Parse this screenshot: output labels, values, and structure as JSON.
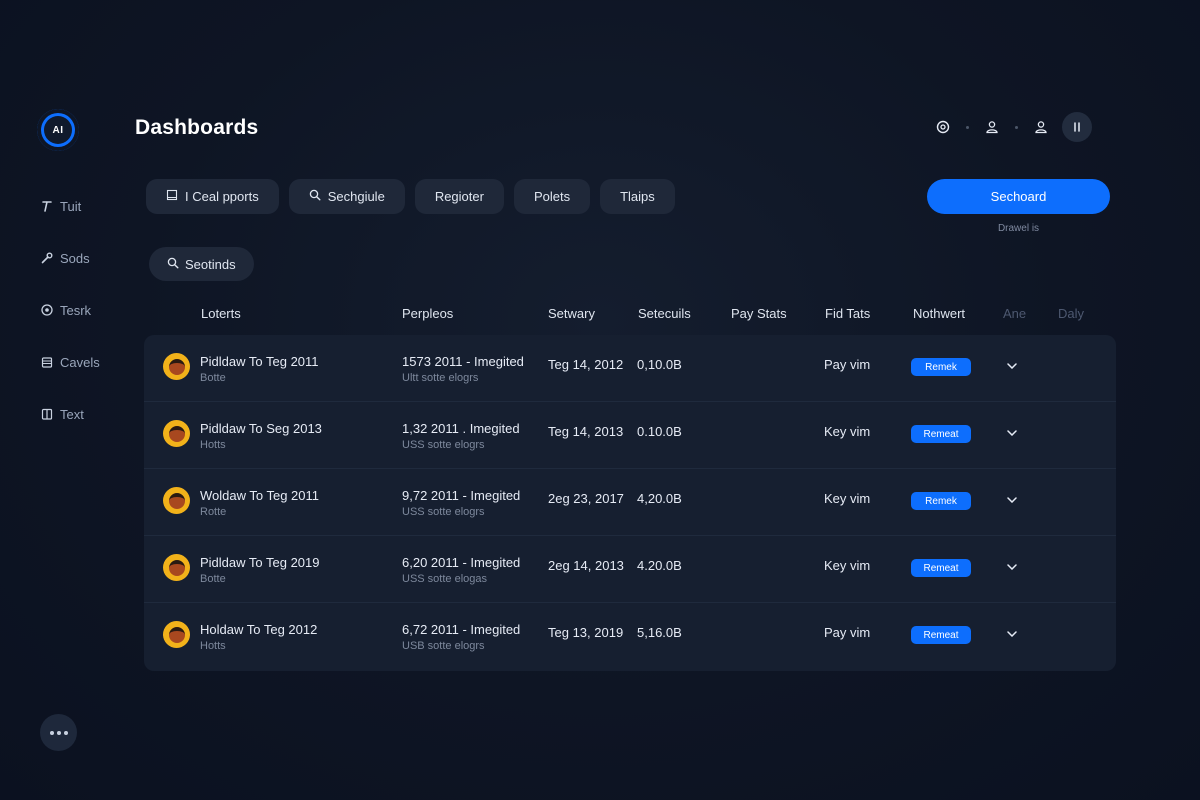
{
  "logo": {
    "text": "AI"
  },
  "sidebar": {
    "items": [
      {
        "label": "Tuit",
        "icon": "text-t-icon"
      },
      {
        "label": "Sods",
        "icon": "wrench-icon"
      },
      {
        "label": "Tesrk",
        "icon": "target-icon"
      },
      {
        "label": "Cavels",
        "icon": "calendar-icon"
      },
      {
        "label": "Text",
        "icon": "book-icon"
      }
    ]
  },
  "header": {
    "title": "Dashboards",
    "icons": [
      "settings-circle-icon",
      "user-icon",
      "user-icon",
      "pause-icon"
    ]
  },
  "filters": [
    {
      "label": "I Ceal pports",
      "icon": "report-icon"
    },
    {
      "label": "Sechgiule",
      "icon": "search-icon"
    },
    {
      "label": "Regioter"
    },
    {
      "label": "Polets"
    },
    {
      "label": "Tlaips"
    }
  ],
  "primary_button": {
    "label": "Sechoard",
    "caption": "Drawel is"
  },
  "search_chip": {
    "label": "Seotinds"
  },
  "table": {
    "columns": [
      "Loterts",
      "Perpleos",
      "Setwary",
      "Setecuils",
      "Pay Stats",
      "Fid Tats",
      "Nothwert",
      "Ane",
      "Daly"
    ],
    "rows": [
      {
        "name": "Pidldaw To Teg 2011",
        "sub": "Botte",
        "detail": "1573 2011 - Imegited",
        "detail_sub": "Ultt sotte elogrs",
        "date": "Teg 14, 2012",
        "amount": "0,10.0B",
        "pay": "Pay vim",
        "badge": "Remek"
      },
      {
        "name": "Pidldaw To Seg 2013",
        "sub": "Hotts",
        "detail": "1,32 2011 . Imegited",
        "detail_sub": "USS sotte elogrs",
        "date": "Teg 14, 2013",
        "amount": "0.10.0B",
        "pay": "Key vim",
        "badge": "Remeat"
      },
      {
        "name": "Woldaw To Teg 2011",
        "sub": "Rotte",
        "detail": "9,72 2011 - Imegited",
        "detail_sub": "USS sotte elogrs",
        "date": "2eg 23, 2017",
        "amount": "4,20.0B",
        "pay": "Key vim",
        "badge": "Remek"
      },
      {
        "name": "Pidldaw To Teg 2019",
        "sub": "Botte",
        "detail": "6,20 2011 - Imegited",
        "detail_sub": "USS sotte elogas",
        "date": "2eg 14, 2013",
        "amount": "4.20.0B",
        "pay": "Key vim",
        "badge": "Remeat"
      },
      {
        "name": "Holdaw To Teg 2012",
        "sub": "Hotts",
        "detail": "6,72 2011 - Imegited",
        "detail_sub": "USB sotte elogrs",
        "date": "Teg 13, 2019",
        "amount": "5,16.0B",
        "pay": "Pay vim",
        "badge": "Remeat"
      }
    ]
  },
  "colors": {
    "accent": "#0d6efd",
    "background": "#0e1524",
    "card": "#161f30",
    "chip": "#1f2839",
    "avatar": "#f2b21a"
  }
}
